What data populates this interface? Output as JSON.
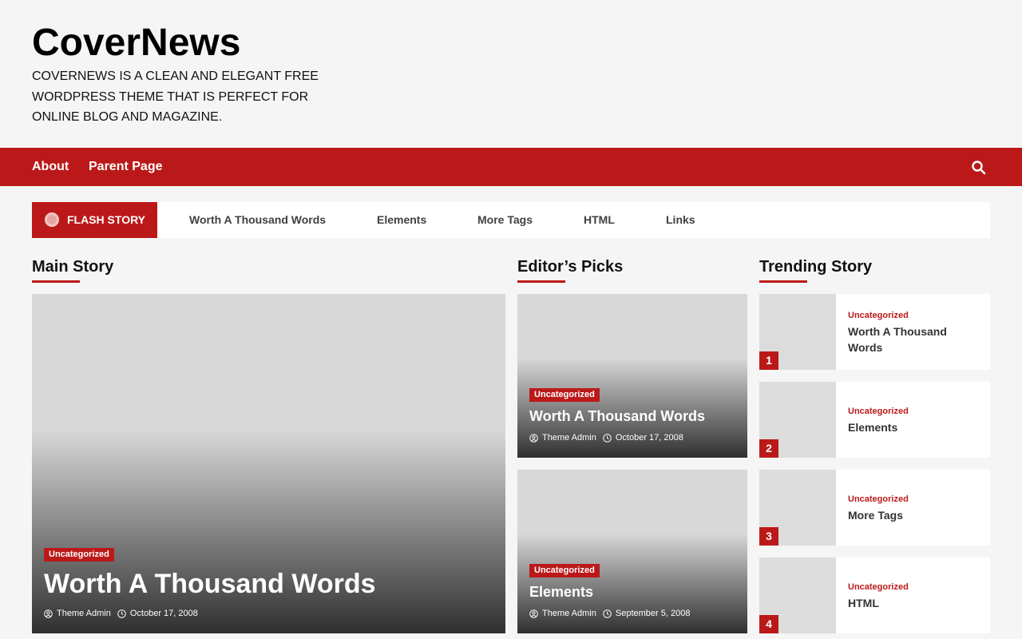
{
  "site": {
    "title": "CoverNews",
    "description": "COVERNEWS IS A CLEAN AND ELEGANT FREE WORDPRESS THEME THAT IS PERFECT FOR ONLINE BLOG AND MAGAZINE."
  },
  "nav": {
    "items": [
      {
        "label": "About"
      },
      {
        "label": "Parent Page"
      }
    ],
    "search_icon": "search-icon"
  },
  "flash": {
    "label": "FLASH STORY",
    "links": [
      {
        "label": "Worth A Thousand Words"
      },
      {
        "label": "Elements"
      },
      {
        "label": "More Tags"
      },
      {
        "label": "HTML"
      },
      {
        "label": "Links"
      }
    ]
  },
  "sections": {
    "main": "Main Story",
    "editors": "Editor’s Picks",
    "trending": "Trending Story"
  },
  "main_story": {
    "category": "Uncategorized",
    "title": "Worth A Thousand Words",
    "author": "Theme Admin",
    "date": "October 17, 2008"
  },
  "editors_picks": [
    {
      "category": "Uncategorized",
      "title": "Worth A Thousand Words",
      "author": "Theme Admin",
      "date": "October 17, 2008"
    },
    {
      "category": "Uncategorized",
      "title": "Elements",
      "author": "Theme Admin",
      "date": "September 5, 2008"
    }
  ],
  "trending": [
    {
      "rank": "1",
      "category": "Uncategorized",
      "title": "Worth A Thousand Words"
    },
    {
      "rank": "2",
      "category": "Uncategorized",
      "title": "Elements"
    },
    {
      "rank": "3",
      "category": "Uncategorized",
      "title": "More Tags"
    },
    {
      "rank": "4",
      "category": "Uncategorized",
      "title": "HTML"
    }
  ],
  "colors": {
    "accent": "#bb1919",
    "background": "#f5f5f5"
  }
}
